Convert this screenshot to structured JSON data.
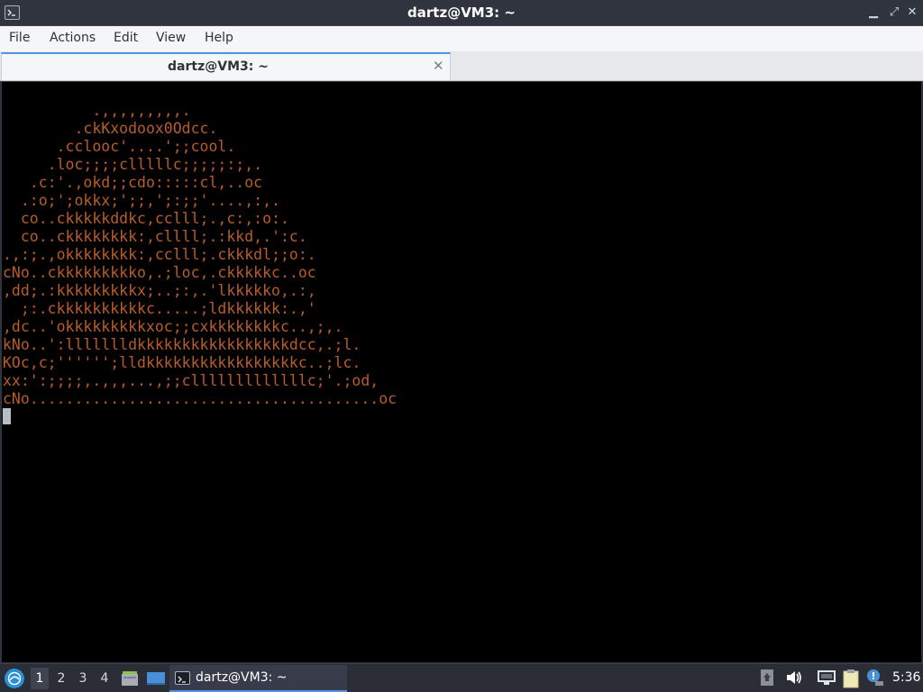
{
  "window": {
    "title": "dartz@VM3: ~",
    "controls": {
      "minimize": "▁",
      "maximize": "⤢",
      "close": "✕"
    }
  },
  "menu": [
    "File",
    "Actions",
    "Edit",
    "View",
    "Help"
  ],
  "tab": {
    "label": "dartz@VM3: ~",
    "close": "✕"
  },
  "terminal": {
    "text_color": "#b85c2a",
    "lines": [
      "          .,,,,,,,,,.",
      "        .ckKxodoox0Odcc.",
      "      .cclooc'....';;cool.",
      "     .loc;;;;clllllc;;;;;:;,.",
      "   .c:'.,okd;;cdo:::::cl,..oc",
      "  .:o;';okkx;';;,';:;;'....,:,.",
      "  co..ckkkkkddkc,cclll;.,c:,:o:.",
      "  co..ckkkkkkkk:,cllll;.:kkd,.':c.",
      ".,:;.,okkkkkkkk:,cclll;.ckkkdl;;o:.",
      "cNo..ckkkkkkkkko,.;loc,.ckkkkkc..oc",
      ",dd;.:kkkkkkkkkx;..;:,.'lkkkkko,.:,",
      "  ;:.ckkkkkkkkkkc.....;ldkkkkkk:.,'",
      ",dc..'okkkkkkkkkxoc;;cxkkkkkkkkc..,;,.",
      "kNo..':llllllldkkkkkkkkkkkkkkkkkdcc,.;l.",
      "KOc,c;'''''';lldkkkkkkkkkkkkkkkkkc..;lc.",
      "xx:':;;;;,.,,,...,;;clllllllllllllc;'.;od,",
      "cNo.......................................oc"
    ]
  },
  "taskbar": {
    "workspaces": [
      "1",
      "2",
      "3",
      "4"
    ],
    "active_workspace": "1",
    "task_label": "dartz@VM3: ~",
    "clock": "5:36",
    "tray_icons": [
      "upload-icon",
      "volume-icon",
      "network-icon",
      "clipboard-icon",
      "update-notifier-icon"
    ]
  },
  "colors": {
    "accent": "#5294e2",
    "titlebar_bg": "#2f343f",
    "terminal_bg": "#000000"
  }
}
